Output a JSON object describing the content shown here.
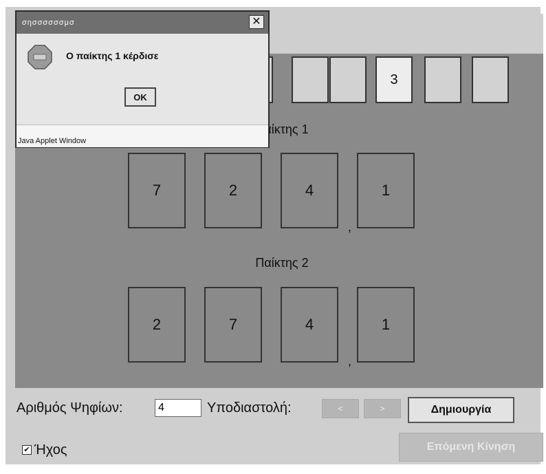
{
  "slots": [
    {
      "value": ""
    },
    {
      "value": ""
    },
    {
      "value": ""
    },
    {
      "value": "3"
    },
    {
      "value": ""
    },
    {
      "value": ""
    }
  ],
  "player1": {
    "label": "Παίκτης 1",
    "cards": [
      "7",
      "2",
      "4",
      "1"
    ],
    "comma": ","
  },
  "player2": {
    "label": "Παίκτης 2",
    "cards": [
      "2",
      "7",
      "4",
      "1"
    ],
    "comma": ","
  },
  "controls": {
    "digits_label": "Αριθμός Ψηφίων:",
    "digits_value": "4",
    "decimal_label": "Υποδιαστολή:",
    "left_arrow": "<",
    "right_arrow": ">",
    "create_button": "Δημιουργία",
    "sound_label": "Ήχος",
    "sound_checked": true,
    "sound_mark": "✔",
    "next_move_button": "Επόμενη Κίνηση"
  },
  "dialog": {
    "title": "σησσσσσσμσ",
    "close_glyph": "✕",
    "message": "Ο παίκτης 1 κέρδισε",
    "ok_label": "OK",
    "footer": "Java Applet Window"
  }
}
